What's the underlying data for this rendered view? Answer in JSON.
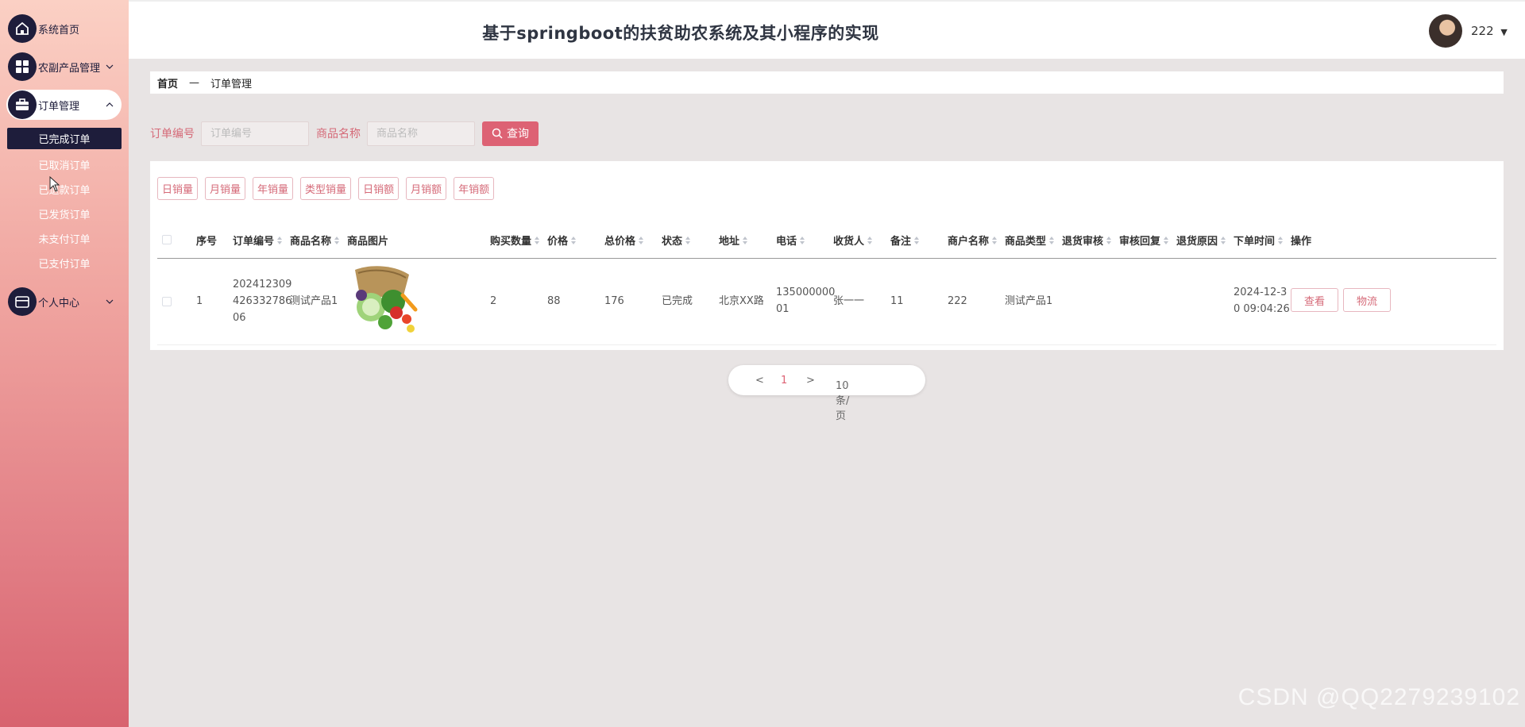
{
  "sidebar": {
    "items": [
      {
        "label": "系统首页"
      },
      {
        "label": "农副产品管理"
      },
      {
        "label": "订单管理"
      },
      {
        "label": "个人中心"
      }
    ],
    "order_submenu": [
      "已完成订单",
      "已取消订单",
      "已退款订单",
      "已发货订单",
      "未支付订单",
      "已支付订单"
    ]
  },
  "header": {
    "title": "基于springboot的扶贫助农系统及其小程序的实现",
    "username": "222"
  },
  "breadcrumb": {
    "home": "首页",
    "separator": "—",
    "current": "订单管理"
  },
  "search": {
    "order_no_label": "订单编号",
    "order_no_placeholder": "订单编号",
    "product_name_label": "商品名称",
    "product_name_placeholder": "商品名称",
    "query_label": "查询"
  },
  "stat_buttons": [
    "日销量",
    "月销量",
    "年销量",
    "类型销量",
    "日销额",
    "月销额",
    "年销额"
  ],
  "table": {
    "columns": [
      "序号",
      "订单编号",
      "商品名称",
      "商品图片",
      "购买数量",
      "价格",
      "总价格",
      "状态",
      "地址",
      "电话",
      "收货人",
      "备注",
      "商户名称",
      "商品类型",
      "退货审核",
      "审核回复",
      "退货原因",
      "下单时间",
      "操作"
    ],
    "rows": [
      {
        "index": "1",
        "order_no_l1": "202412309",
        "order_no_l2": "426332786",
        "order_no_l3": "06",
        "product_name": "测试产品1",
        "quantity": "2",
        "price": "88",
        "total": "176",
        "status": "已完成",
        "address": "北京XX路",
        "phone_l1": "135000000",
        "phone_l2": "01",
        "receiver": "张一一",
        "remark": "11",
        "merchant": "222",
        "product_type": "测试产品1",
        "return_audit": "",
        "audit_reply": "",
        "return_reason": "",
        "order_time_l1": "2024-12-3",
        "order_time_l2": "0 09:04:26",
        "view_label": "查看",
        "logistics_label": "物流"
      }
    ]
  },
  "pagination": {
    "prev": "<",
    "current_page": "1",
    "next": ">",
    "page_size": "10条/页"
  },
  "watermark": "CSDN @QQ2279239102",
  "colors": {
    "accent": "#dd6274",
    "nav_dark": "#1e1d3b",
    "label_pink": "#d56a78"
  }
}
